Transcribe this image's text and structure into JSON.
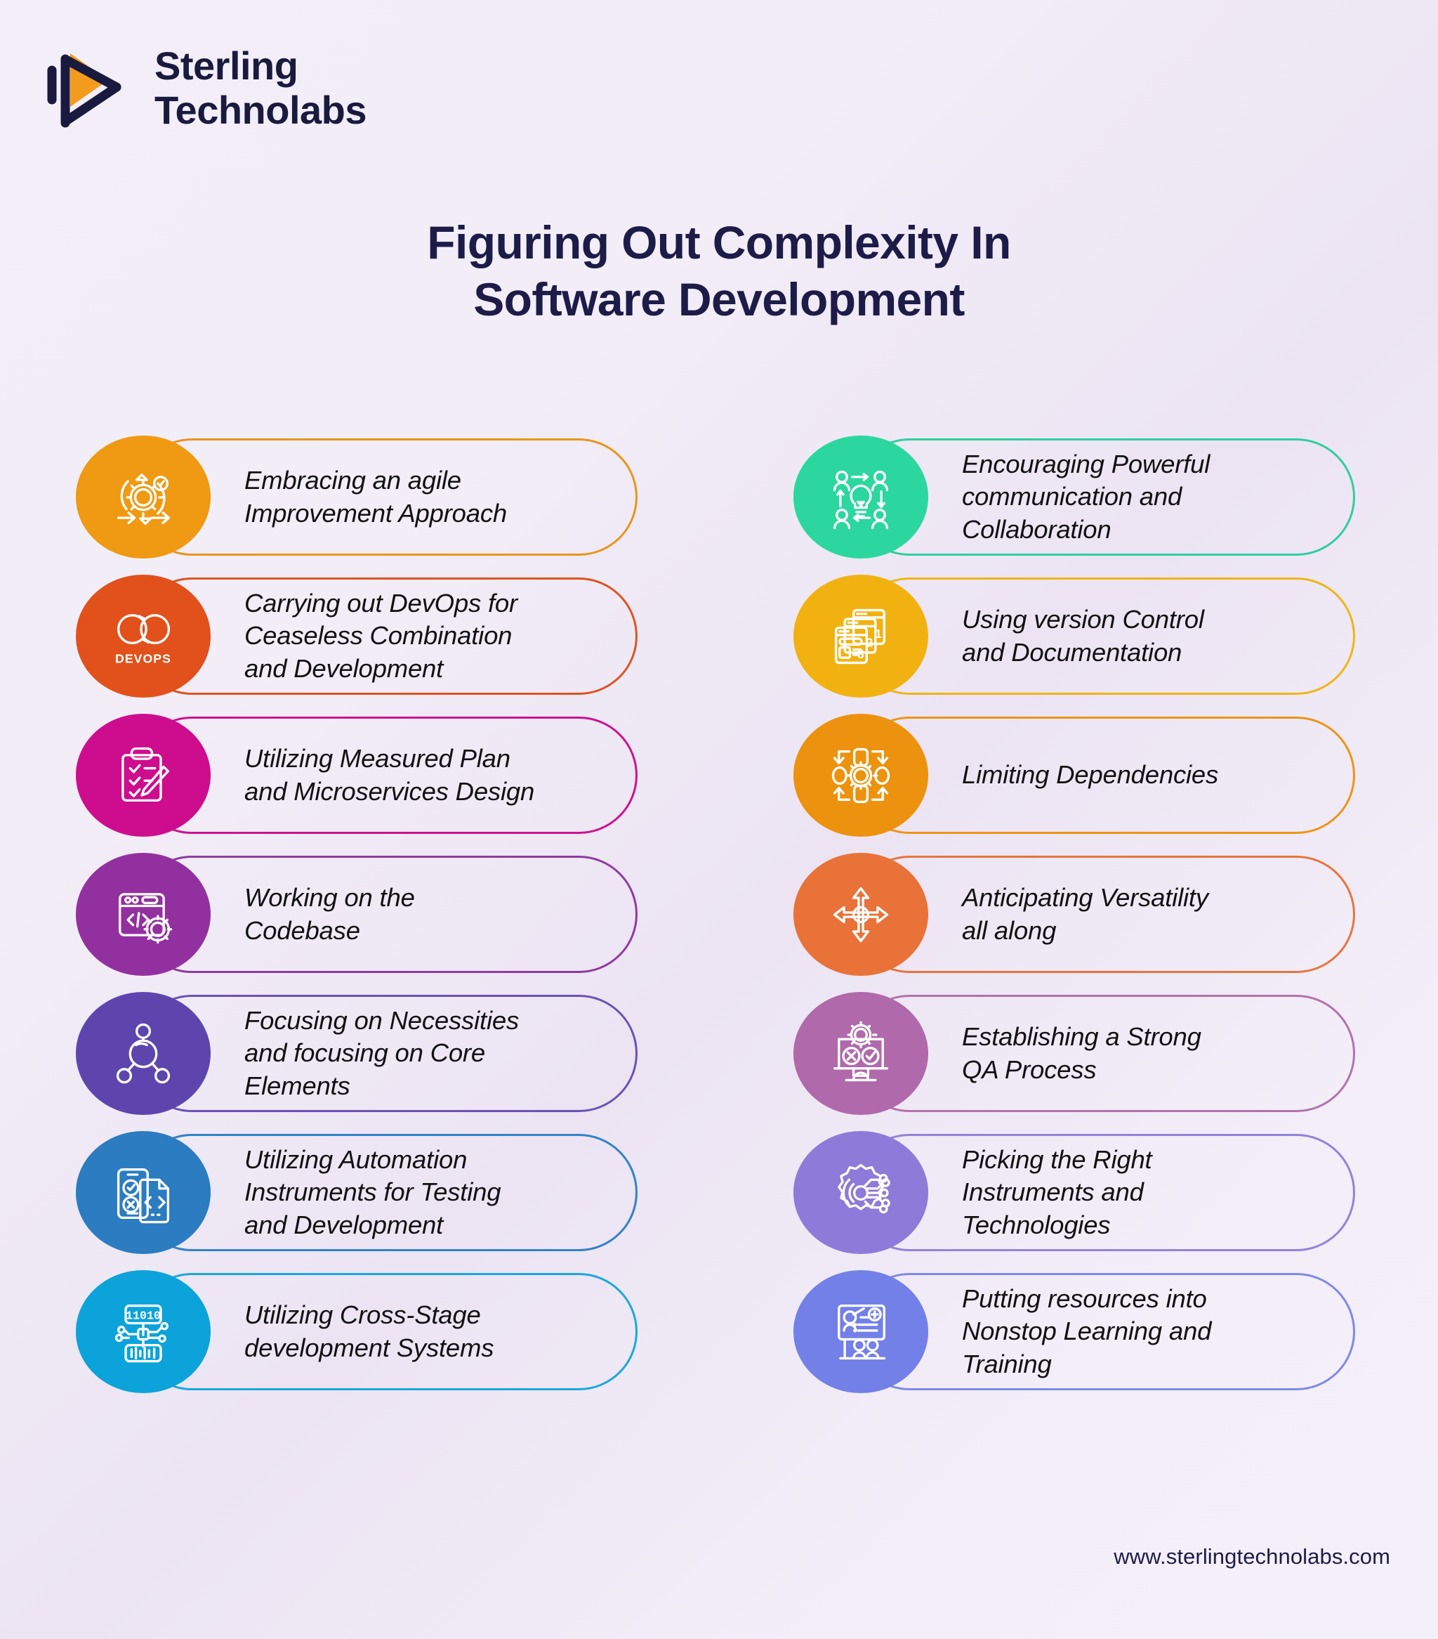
{
  "brand": {
    "name": "Sterling\nTechnolabs",
    "logo_icon": "play-chevron-logo",
    "logo_accent": "#F39B1C",
    "logo_dark": "#191A3E"
  },
  "title": "Figuring Out Complexity In\nSoftware Development",
  "footer": {
    "website": "www.sterlingtechnolabs.com"
  },
  "colors": {
    "background_start": "#F3EFF8",
    "background_mid": "#ECE4F3",
    "background_end": "#F4F0F9",
    "text_dark": "#1D1C48",
    "label_text": "#111111"
  },
  "left_column": [
    {
      "label": "Embracing an agile\nImprovement Approach",
      "icon": "agile-cycle-gear-icon",
      "color": "#EF9A12",
      "border": "#E9951A"
    },
    {
      "label": "Carrying out DevOps for\nCeaseless Combination\nand Development",
      "icon": "devops-infinity-icon",
      "color": "#E2511B",
      "border": "#DE5320"
    },
    {
      "label": "Utilizing Measured Plan\nand Microservices Design",
      "icon": "clipboard-checklist-pencil-icon",
      "color": "#CE0D8E",
      "border": "#CC1290"
    },
    {
      "label": "Working on the\nCodebase",
      "icon": "code-window-gear-icon",
      "color": "#93309F",
      "border": "#8E3BA0"
    },
    {
      "label": "Focusing on Necessities\nand focusing  on Core\nElements",
      "icon": "node-network-icon",
      "color": "#5E45AE",
      "border": "#6A52B4"
    },
    {
      "label": "Utilizing Automation\nInstruments for Testing\nand Development",
      "icon": "mobile-test-code-icon",
      "color": "#2B7CC0",
      "border": "#3282C6"
    },
    {
      "label": "Utilizing Cross-Stage\ndevelopment Systems",
      "icon": "binary-circuit-board-icon",
      "color": "#0BA3DA",
      "border": "#19A8DC"
    }
  ],
  "right_column": [
    {
      "label": "Encouraging Powerful\ncommunication and\nCollaboration",
      "icon": "team-lightbulb-collaboration-icon",
      "color": "#2BD79E",
      "border": "#2ECF9B"
    },
    {
      "label": "Using version Control\nand Documentation",
      "icon": "stacked-versions-windows-icon",
      "color": "#F1B211",
      "border": "#F0B516"
    },
    {
      "label": "Limiting Dependencies",
      "icon": "dependency-loop-gear-icon",
      "color": "#ED920E",
      "border": "#EC9514"
    },
    {
      "label": "Anticipating Versatility\nall along",
      "icon": "four-direction-arrows-icon",
      "color": "#E97239",
      "border": "#E6753E"
    },
    {
      "label": "Establishing a Strong\nQA Process",
      "icon": "monitor-qa-gear-icon",
      "color": "#B069AB",
      "border": "#B272AD"
    },
    {
      "label": "Picking the Right\nInstruments and\nTechnologies",
      "icon": "gear-circuit-nodes-icon",
      "color": "#8E7AD8",
      "border": "#9283DA"
    },
    {
      "label": "Putting resources into\nNonstop Learning and\nTraining",
      "icon": "training-presentation-icon",
      "color": "#7380E8",
      "border": "#7D89EA"
    }
  ]
}
